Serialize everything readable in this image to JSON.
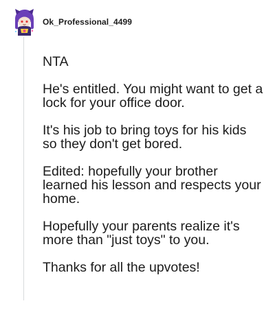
{
  "comment": {
    "author": "Ok_Professional_4499",
    "avatar_icon": "snoo-avatar-icon",
    "paragraphs": [
      "NTA",
      "He's entitled. You might want to get a lock for your office door.",
      "It's his job to bring toys for his kids so they don't get bored.",
      "Edited: hopefully your brother learned his lesson and respects your home.",
      "Hopefully your parents realize it's more than \"just toys\" to you.",
      "Thanks for all the upvotes!"
    ]
  },
  "colors": {
    "text": "#1c1c1c",
    "thread_line": "#d8dadc",
    "avatar_purple": "#6a3fb8"
  }
}
